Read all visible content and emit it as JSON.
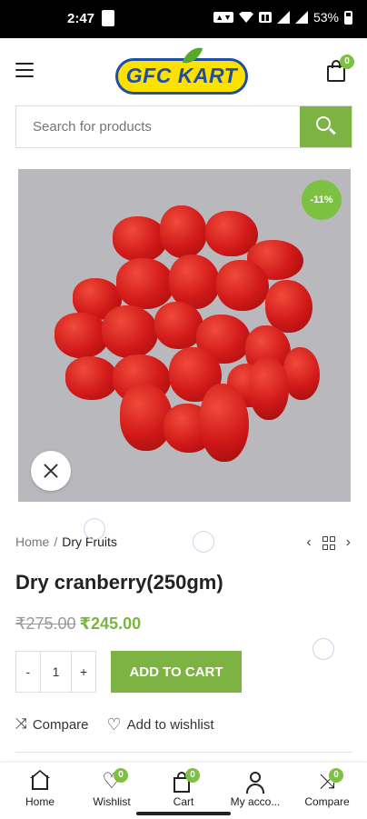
{
  "status_bar": {
    "time": "2:47",
    "battery": "53%"
  },
  "header": {
    "logo_text": "GFC KART",
    "cart_count": "0"
  },
  "search": {
    "placeholder": "Search for products"
  },
  "product": {
    "discount_badge": "-11%",
    "breadcrumb": {
      "home": "Home",
      "separator": "/",
      "current": "Dry Fruits"
    },
    "title": "Dry cranberry(250gm)",
    "old_price": "₹275.00",
    "new_price": "₹245.00",
    "quantity": {
      "minus": "-",
      "value": "1",
      "plus": "+"
    },
    "add_to_cart": "ADD TO CART",
    "compare_label": "Compare",
    "wishlist_label": "Add to wishlist"
  },
  "bottom_nav": [
    {
      "label": "Home",
      "icon": "home-icon"
    },
    {
      "label": "Wishlist",
      "icon": "heart-icon",
      "badge": "0"
    },
    {
      "label": "Cart",
      "icon": "cart-icon",
      "badge": "0"
    },
    {
      "label": "My acco...",
      "icon": "user-icon"
    },
    {
      "label": "Compare",
      "icon": "shuffle-icon",
      "badge": "0"
    }
  ],
  "colors": {
    "accent": "#7cb342",
    "badge": "#7cc142",
    "logo_blue": "#1f4fa0",
    "logo_yellow": "#ffe100"
  }
}
